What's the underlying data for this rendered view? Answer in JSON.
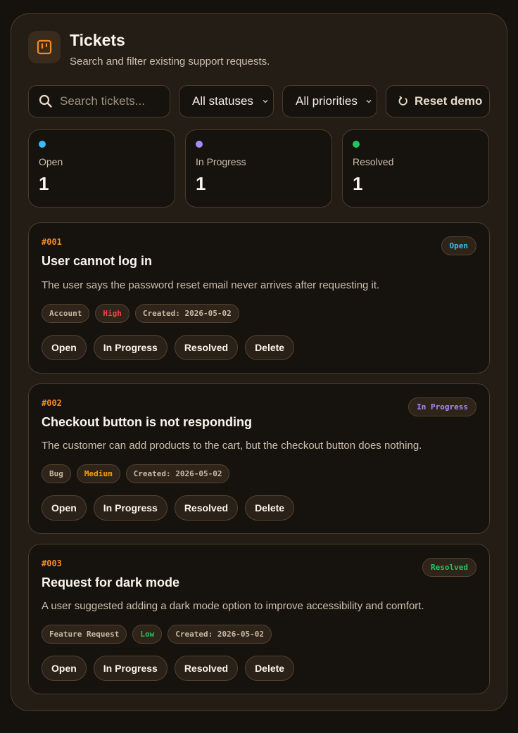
{
  "header": {
    "title": "Tickets",
    "subtitle": "Search and filter existing support requests.",
    "logo_icon": "kanban-board-icon"
  },
  "toolbar": {
    "search_placeholder": "Search tickets...",
    "status_filter": "All statuses",
    "priority_filter": "All priorities",
    "reset_label": "Reset demo"
  },
  "stats": [
    {
      "label": "Open",
      "count": "1",
      "color": "#38bdf8"
    },
    {
      "label": "In Progress",
      "count": "1",
      "color": "#a78bfa"
    },
    {
      "label": "Resolved",
      "count": "1",
      "color": "#22c55e"
    }
  ],
  "tickets": [
    {
      "id": "#001",
      "title": "User cannot log in",
      "description": "The user says the password reset email never arrives after requesting it.",
      "status": "Open",
      "status_color": "#38bdf8",
      "category": "Account",
      "priority": "High",
      "priority_color": "#ef4444",
      "created": "Created: 2026-05-02"
    },
    {
      "id": "#002",
      "title": "Checkout button is not responding",
      "description": "The customer can add products to the cart, but the checkout button does nothing.",
      "status": "In Progress",
      "status_color": "#a78bfa",
      "category": "Bug",
      "priority": "Medium",
      "priority_color": "#f59e0b",
      "created": "Created: 2026-05-02"
    },
    {
      "id": "#003",
      "title": "Request for dark mode",
      "description": "A user suggested adding a dark mode option to improve accessibility and comfort.",
      "status": "Resolved",
      "status_color": "#22c55e",
      "category": "Feature Request",
      "priority": "Low",
      "priority_color": "#22c55e",
      "created": "Created: 2026-05-02"
    }
  ],
  "ticket_actions": {
    "open": "Open",
    "in_progress": "In Progress",
    "resolved": "Resolved",
    "delete": "Delete"
  },
  "colors": {
    "accent": "#f08b2c",
    "page_background": "#15110d",
    "panel_background": "#241d16"
  }
}
